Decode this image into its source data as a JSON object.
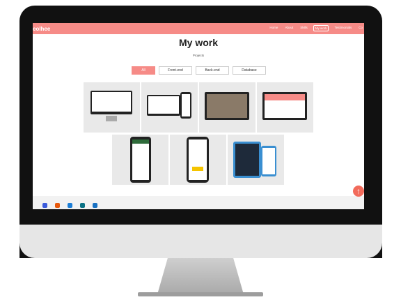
{
  "navbar": {
    "brand": "eolhee",
    "items": [
      {
        "label": "Home",
        "active": false
      },
      {
        "label": "About",
        "active": false
      },
      {
        "label": "Skills",
        "active": false
      },
      {
        "label": "My work",
        "active": true
      },
      {
        "label": "Testimonials",
        "active": false
      },
      {
        "label": "Co",
        "active": false
      }
    ]
  },
  "hero": {
    "title": "My work",
    "subtitle": "Projects"
  },
  "filters": [
    {
      "label": "All",
      "active": true
    },
    {
      "label": "Front-end",
      "active": false
    },
    {
      "label": "Back-end",
      "active": false
    },
    {
      "label": "Database",
      "active": false
    }
  ],
  "projects": [
    {
      "device": "desktop-monitor-icon"
    },
    {
      "device": "laptop-and-phone-icon"
    },
    {
      "device": "laptop-gallery-icon"
    },
    {
      "device": "laptop-profile-icon"
    },
    {
      "device": "phone-list-icon"
    },
    {
      "device": "phone-app-icon"
    },
    {
      "device": "tablet-and-phone-icon"
    }
  ],
  "scroll_top": {
    "icon": "arrow-up-icon"
  },
  "colors": {
    "accent": "#f68b87",
    "scroll_button": "#f26b5b"
  }
}
